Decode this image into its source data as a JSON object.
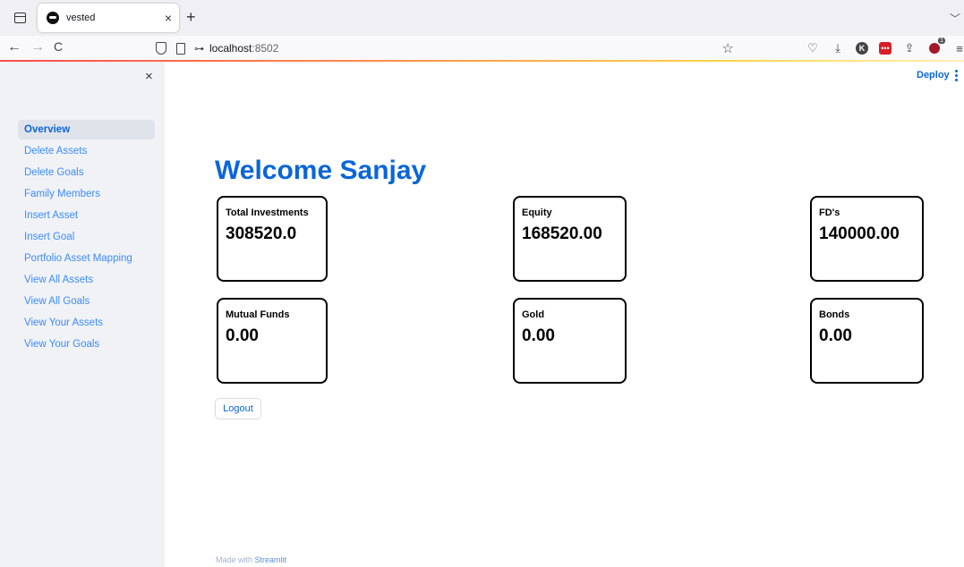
{
  "browser": {
    "tab_title": "vested",
    "tab_close": "×",
    "new_tab": "+",
    "list_tabs": "﹀",
    "nav_back": "←",
    "nav_forward": "→",
    "nav_reload": "C",
    "url_host": "localhost",
    "url_port": ":8502",
    "bookmark_star": "☆",
    "toolbar": {
      "pocket": "♡",
      "download": "⤓",
      "profile_letter": "K",
      "extension_red": "•••",
      "share": "⇪",
      "extension_badge": "1",
      "overflow": "≡"
    }
  },
  "sidebar": {
    "close": "×",
    "items": [
      {
        "label": "Overview"
      },
      {
        "label": "Delete Assets"
      },
      {
        "label": "Delete Goals"
      },
      {
        "label": "Family Members"
      },
      {
        "label": "Insert Asset"
      },
      {
        "label": "Insert Goal"
      },
      {
        "label": "Portfolio Asset Mapping"
      },
      {
        "label": "View All Assets"
      },
      {
        "label": "View All Goals"
      },
      {
        "label": "View Your Assets"
      },
      {
        "label": "View Your Goals"
      }
    ]
  },
  "header": {
    "deploy_label": "Deploy"
  },
  "main": {
    "welcome": "Welcome Sanjay",
    "cards": [
      {
        "label": "Total Investments",
        "value": "308520.0"
      },
      {
        "label": "Equity",
        "value": "168520.00"
      },
      {
        "label": "FD's",
        "value": "140000.00"
      },
      {
        "label": "Mutual Funds",
        "value": "0.00"
      },
      {
        "label": "Gold",
        "value": "0.00"
      },
      {
        "label": "Bonds",
        "value": "0.00"
      }
    ],
    "logout_label": "Logout"
  },
  "footer": {
    "prefix": "Made with ",
    "brand": "Streamlit"
  },
  "colors": {
    "accent": "#0a66d8",
    "sidebar_bg": "#f0f2f6",
    "sidebar_link": "#3d8bfd"
  }
}
